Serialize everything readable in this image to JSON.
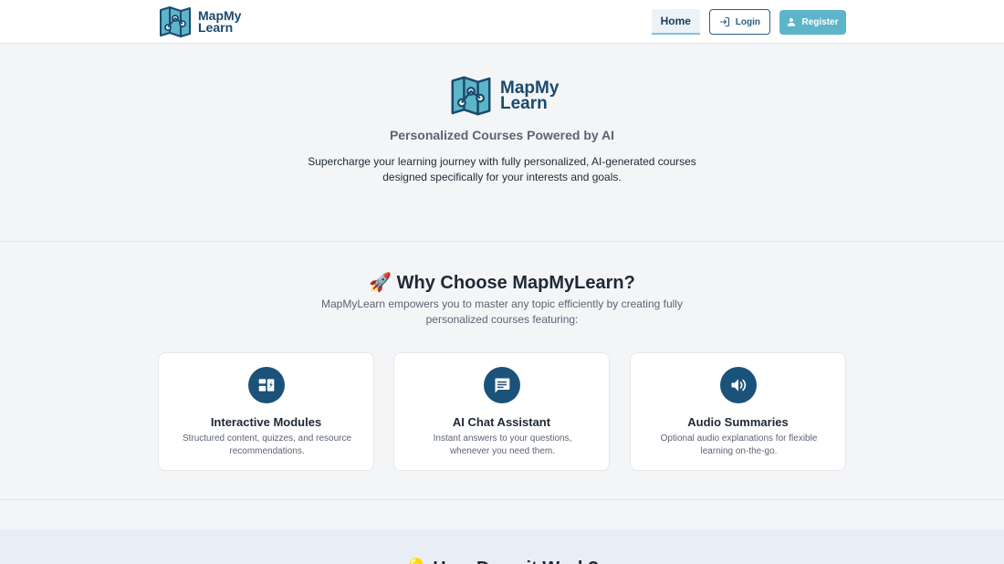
{
  "header": {
    "logo_line1": "MapMy",
    "logo_line2": "Learn",
    "nav": {
      "home": "Home",
      "login": "Login",
      "register": "Register"
    }
  },
  "hero": {
    "logo_line1": "MapMy",
    "logo_line2": "Learn",
    "title": "Personalized Courses Powered by AI",
    "description": "Supercharge your learning journey with fully personalized, AI-generated courses designed specifically for your interests and goals."
  },
  "why": {
    "title": "🚀 Why Choose MapMyLearn?",
    "description": "MapMyLearn empowers you to master any topic efficiently by creating fully personalized courses featuring:",
    "features": [
      {
        "icon": "dashboard-icon",
        "title": "Interactive Modules",
        "description": "Structured content, quizzes, and resource recommendations."
      },
      {
        "icon": "chat-icon",
        "title": "AI Chat Assistant",
        "description": "Instant answers to your questions, whenever you need them."
      },
      {
        "icon": "volume-icon",
        "title": "Audio Summaries",
        "description": "Optional audio explanations for flexible learning on-the-go."
      }
    ]
  },
  "how": {
    "title": "💡 How Does it Work?"
  },
  "colors": {
    "brand_dark": "#1a527a",
    "brand_accent": "#5db5c9",
    "logo_text": "#1a4a6e"
  }
}
